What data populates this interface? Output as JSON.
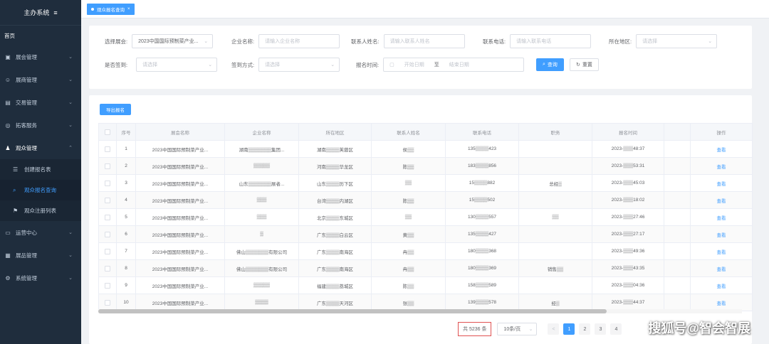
{
  "sidebar": {
    "title": "主办系统",
    "menu_icon": "≡",
    "home": "首页",
    "items": [
      {
        "label": "展会管理",
        "icon": "building-icon"
      },
      {
        "label": "展商管理",
        "icon": "users-icon"
      },
      {
        "label": "交易管理",
        "icon": "trade-icon"
      },
      {
        "label": "拓客服务",
        "icon": "service-icon"
      },
      {
        "label": "观众管理",
        "icon": "audience-icon"
      }
    ],
    "sub_items": [
      {
        "label": "创建报名表",
        "icon": "list-icon"
      },
      {
        "label": "观众报名查询",
        "icon": "search-icon"
      },
      {
        "label": "观众注册列表",
        "icon": "register-icon"
      }
    ],
    "items_after": [
      {
        "label": "运营中心",
        "icon": "ops-icon"
      },
      {
        "label": "展品管理",
        "icon": "exhibit-icon"
      },
      {
        "label": "系统管理",
        "icon": "settings-icon"
      }
    ]
  },
  "tab": {
    "label": "观众报名查询"
  },
  "filters": {
    "expo_label": "选择展会:",
    "expo_value": "2023中国国际预制菜产业...",
    "company_label": "企业名称:",
    "company_placeholder": "请输入企业名称",
    "contact_label": "联系人姓名:",
    "contact_placeholder": "请输入联系人姓名",
    "phone_label": "联系电话:",
    "phone_placeholder": "请输入联系电话",
    "region_label": "所在地区:",
    "region_placeholder": "请选择",
    "signed_label": "是否签到:",
    "signed_placeholder": "请选择",
    "signmethod_label": "签到方式:",
    "signmethod_placeholder": "请选择",
    "time_label": "报名时间:",
    "start_placeholder": "开始日期",
    "to": "至",
    "end_placeholder": "结束日期",
    "search": "查询",
    "reset": "重置"
  },
  "table": {
    "export": "导出报名",
    "headers": [
      "序号",
      "展会名称",
      "企业名称",
      "所在地区",
      "联系人姓名",
      "联系电话",
      "职务",
      "报名时间",
      "",
      "操作"
    ],
    "rows": [
      {
        "no": "1",
        "expo": "2023中国国际预制菜产业...",
        "company": "湖南▒▒▒▒▒▒▒集团...",
        "region": "湖南▒▒▒▒芙蓉区",
        "contact": "侯▒▒",
        "phone": "135▒▒▒▒423",
        "title": "",
        "time": "2023-▒▒▒48:37",
        "op": "查看"
      },
      {
        "no": "2",
        "expo": "2023中国国际预制菜产业...",
        "company": "▒▒▒▒▒",
        "region": "河南▒▒▒▒华龙区",
        "contact": "陈▒▒",
        "phone": "183▒▒▒▒856",
        "title": "",
        "time": "2023-▒▒▒53:31",
        "op": "查看"
      },
      {
        "no": "3",
        "expo": "2023中国国际预制菜产业...",
        "company": "山东▒▒▒▒▒▒▒展者...",
        "region": "山东▒▒▒▒历下区",
        "contact": "▒▒",
        "phone": "15▒▒▒▒882",
        "title": "总经▒",
        "time": "2023-▒▒▒45:03",
        "op": "查看"
      },
      {
        "no": "4",
        "expo": "2023中国国际预制菜产业...",
        "company": "▒▒▒",
        "region": "台湾▒▒▒▒内湖区",
        "contact": "陈▒▒",
        "phone": "15▒▒▒▒502",
        "title": "",
        "time": "2023-▒▒▒18:02",
        "op": "查看"
      },
      {
        "no": "5",
        "expo": "2023中国国际预制菜产业...",
        "company": "▒▒▒",
        "region": "北京▒▒▒▒东城区",
        "contact": "▒▒",
        "phone": "130▒▒▒▒557",
        "title": "▒▒",
        "time": "2023-▒▒▒27:46",
        "op": "查看"
      },
      {
        "no": "6",
        "expo": "2023中国国际预制菜产业...",
        "company": "▒",
        "region": "广东▒▒▒▒白云区",
        "contact": "黄▒▒",
        "phone": "135▒▒▒▒427",
        "title": "",
        "time": "2023-▒▒▒27:17",
        "op": "查看"
      },
      {
        "no": "7",
        "expo": "2023中国国际预制菜产业...",
        "company": "佛山▒▒▒▒▒▒▒有限公司",
        "region": "广东▒▒▒▒南海区",
        "contact": "冉▒▒",
        "phone": "180▒▒▒▒368",
        "title": "",
        "time": "2023-▒▒▒49:36",
        "op": "查看"
      },
      {
        "no": "8",
        "expo": "2023中国国际预制菜产业...",
        "company": "佛山▒▒▒▒▒▒▒有限公司",
        "region": "广东▒▒▒▒南海区",
        "contact": "冉▒▒",
        "phone": "180▒▒▒▒369",
        "title": "销售▒▒",
        "time": "2023-▒▒▒43:35",
        "op": "查看"
      },
      {
        "no": "9",
        "expo": "2023中国国际预制菜产业...",
        "company": "▒▒▒▒▒",
        "region": "福建▒▒▒▒荔城区",
        "contact": "陈▒▒",
        "phone": "158▒▒▒▒589",
        "title": "",
        "time": "2023-▒▒▒04:36",
        "op": "查看"
      },
      {
        "no": "10",
        "expo": "2023中国国际预制菜产业...",
        "company": "▒▒▒▒",
        "region": "广东▒▒▒▒天河区",
        "contact": "张▒▒",
        "phone": "139▒▒▒▒578",
        "title": "经▒",
        "time": "2023-▒▒▒44:37",
        "op": "查看"
      }
    ]
  },
  "pagination": {
    "total": "共 5236 条",
    "size": "10条/页",
    "prev": "<",
    "pages": [
      "1",
      "2",
      "3",
      "4"
    ],
    "current": "1"
  },
  "watermark": "搜狐号@智会智展",
  "colors": {
    "primary": "#409eff",
    "sidebar": "#1f2d3d",
    "highlight_border": "#e05252"
  }
}
